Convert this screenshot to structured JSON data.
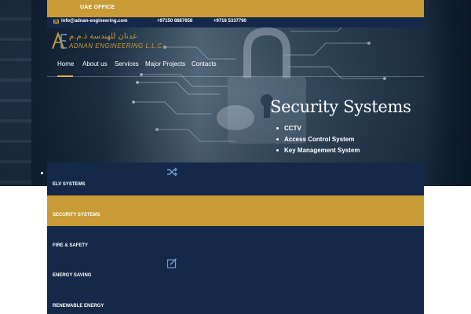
{
  "topbar": {
    "office_label": "UAE OFFICE",
    "email": "info@adnan-engineering.com",
    "phone1": "+97150 8887658",
    "phone2": "+9716 5337790"
  },
  "logo": {
    "arabic": "عدنان للهندسة ذ.م.م",
    "english": "ADNAN ENGINEERING L.L.C"
  },
  "nav": {
    "items": [
      {
        "label": "Home",
        "active": true
      },
      {
        "label": "About us"
      },
      {
        "label": "Services"
      },
      {
        "label": "Major Projects"
      },
      {
        "label": "Contacts"
      }
    ]
  },
  "slide": {
    "title": "Security Systems",
    "items": [
      "CCTV",
      "Access Control System",
      "Key Management System"
    ]
  },
  "services": {
    "items": [
      {
        "label": "ELV SYSTEMS",
        "icon": "shuffle-icon"
      },
      {
        "label": "SECURITY SYSTEMS",
        "active": true
      },
      {
        "label": "FIRE & SAFETY",
        "icon": "edit-icon"
      },
      {
        "label": "ENERGY SAVING"
      },
      {
        "label": "RENEWABLE ENERGY"
      }
    ]
  },
  "colors": {
    "gold": "#c89b36",
    "navy": "#14294a"
  }
}
